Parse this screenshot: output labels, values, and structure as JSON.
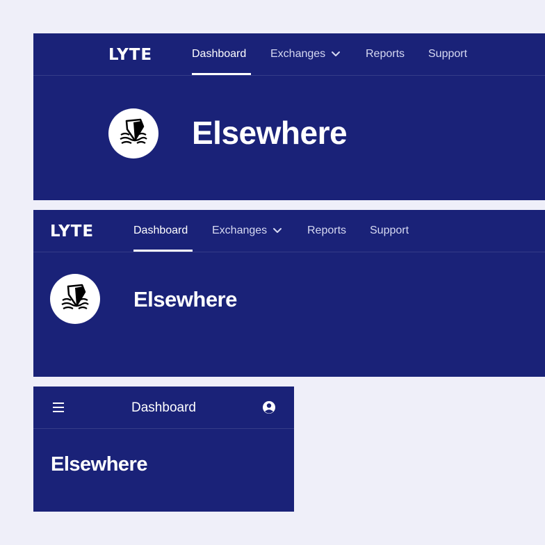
{
  "brand": {
    "logo_text": "LYTE"
  },
  "nav": {
    "items": [
      {
        "label": "Dashboard",
        "active": true
      },
      {
        "label": "Exchanges",
        "has_dropdown": true
      },
      {
        "label": "Reports"
      },
      {
        "label": "Support"
      }
    ]
  },
  "page": {
    "title": "Elsewhere",
    "avatar_icon": "iceberg-icon"
  },
  "mobile": {
    "title": "Dashboard",
    "menu_icon": "hamburger-menu-icon",
    "account_icon": "user-circle-icon"
  },
  "colors": {
    "background": "#efeff9",
    "panel": "#1a2278",
    "text": "#ffffff"
  }
}
